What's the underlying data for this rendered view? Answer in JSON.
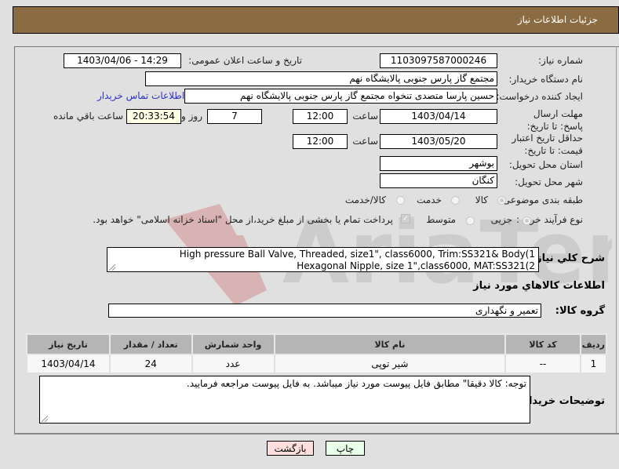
{
  "header": {
    "title": "جزئیات اطلاعات نیاز"
  },
  "form": {
    "need_number_label": "شماره نیاز:",
    "need_number": "1103097587000246",
    "announce_label": "تاریخ و ساعت اعلان عمومی:",
    "announce_value": "1403/04/06 - 14:29",
    "buyer_org_label": "نام دستگاه خریدار:",
    "buyer_org": "مجتمع گاز پارس جنوبی  پالایشگاه نهم",
    "requester_label": "ایجاد کننده درخواست:",
    "requester": "حسین پارسا متصدی تنخواه مجتمع گاز پارس جنوبی  پالایشگاه نهم",
    "buyer_contact_link": "اطلاعات تماس خریدار",
    "deadline_label": "مهلت ارسال پاسخ: تا تاریخ:",
    "deadline_date": "1403/04/14",
    "time_label": "ساعت",
    "deadline_time": "12:00",
    "days_remaining": "7",
    "days_and_label": "روز و",
    "time_remaining": "20:33:54",
    "time_remaining_label": "ساعت باقي مانده",
    "price_validity_label": "حداقل تاریخ اعتبار قیمت: تا تاریخ:",
    "price_validity_date": "1403/05/20",
    "price_validity_time": "12:00",
    "province_label": "استان محل تحویل:",
    "province": "بوشهر",
    "city_label": "شهر محل تحویل:",
    "city": "کنگان",
    "category_label": "طبقه بندی موضوعی:",
    "category_options": [
      "کالا",
      "خدمت",
      "کالا/خدمت"
    ],
    "category_selected": "کالا",
    "purchase_type_label": "نوع فرآیند خرید :",
    "purchase_type_options": [
      "جزیی",
      "متوسط"
    ],
    "purchase_type_selected": "جزیی",
    "treasury_note": "پرداخت تمام یا بخشی از مبلغ خرید،از محل \"اسناد خزانه اسلامی\" خواهد بود.",
    "description_label": "شرح کلي نياز:",
    "description_lines": [
      "High pressure Ball Valve, Threaded, size1\", class6000, Trim:SS321& Body(1",
      "Hexagonal Nipple, size 1\",class6000, MAT:SS321(2"
    ]
  },
  "goods": {
    "section_title": "اطلاعات کالاهاي مورد نياز",
    "group_label": "گروه کالا:",
    "group_value": "تعمیر و نگهداری",
    "columns": [
      "ردیف",
      "کد کالا",
      "نام کالا",
      "واحد شمارش",
      "تعداد / مقدار",
      "تاریخ نیاز"
    ],
    "rows": [
      [
        "1",
        "--",
        "شیر توپی",
        "عدد",
        "24",
        "1403/04/14"
      ]
    ]
  },
  "buyer_notes": {
    "label": "توضیحات خریدار:",
    "text": "توجه: کالا دقیقا\" مطابق فایل پیوست مورد نیاز میباشد. به فایل پیوست مراجعه فرمایید."
  },
  "buttons": {
    "print": "چاپ",
    "back": "بازگشت"
  },
  "colors": {
    "header": "#8b6b42",
    "print_bg": "#eaffea",
    "back_bg": "#ffdede",
    "link": "#2d2dcc"
  }
}
